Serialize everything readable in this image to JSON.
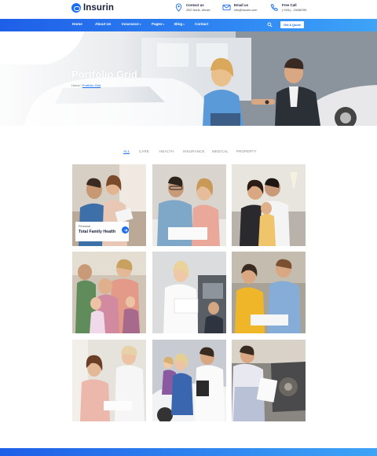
{
  "brand": {
    "name": "Insurin",
    "accent": "#1a6cf0"
  },
  "contacts": [
    {
      "label": "Contact us",
      "value": "25/2 Norla, Ukrain",
      "icon": "location-pin-icon"
    },
    {
      "label": "Email us",
      "value": "info@insurin.com",
      "icon": "email-icon"
    },
    {
      "label": "Free Call",
      "value": "(+001) - 23456789",
      "icon": "phone-icon"
    }
  ],
  "nav": {
    "items": [
      {
        "label": "Home",
        "caret": ""
      },
      {
        "label": "About Us",
        "caret": ""
      },
      {
        "label": "Insurance",
        "caret": "▾"
      },
      {
        "label": "Pages",
        "caret": "▾"
      },
      {
        "label": "Blog",
        "caret": "▾"
      },
      {
        "label": "Contact",
        "caret": ""
      }
    ],
    "quote_label": "Get A Quote"
  },
  "hero": {
    "title": "Portfolio Grid",
    "breadcrumb_home": "Home",
    "breadcrumb_sep": "\\",
    "breadcrumb_current": "Portfolio Grid"
  },
  "filters": [
    "ALL",
    "CARE",
    "HEALTH",
    "INSURANCE",
    "MEDICAL",
    "PROPERTY"
  ],
  "featured_card": {
    "category": "Personal",
    "title": "Total Family Health",
    "button_icon": "arrow-right-icon"
  }
}
